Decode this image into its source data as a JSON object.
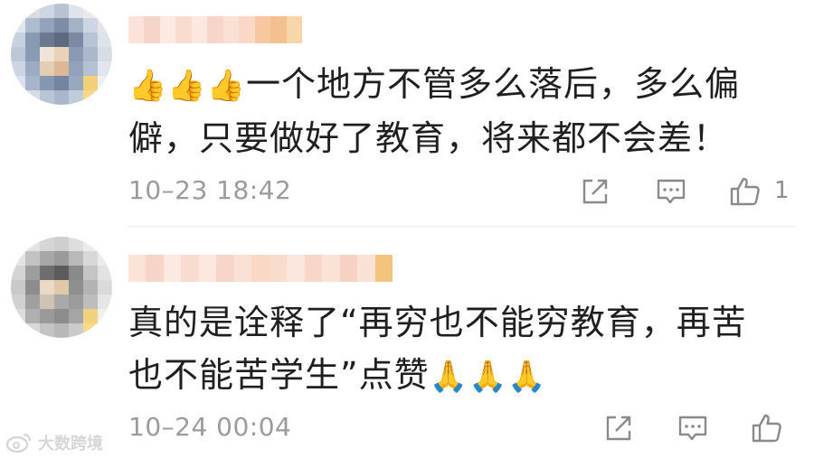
{
  "comments": [
    {
      "text_prefix": "👍👍👍",
      "text": "一个地方不管多么落后，多么偏僻，只要做好了教育，将来都不会差！",
      "time": "10–23 18:42",
      "like_count": "1",
      "avatar_colors": [
        "#e9e9e9",
        "#dcdcdc",
        "#cfd6e3",
        "#b8c2d1",
        "#dde4ec",
        "#eaeaea",
        "#f1f1f1",
        "#dfe6ee",
        "#aebccf",
        "#93a3ba",
        "#7d8da5",
        "#a4b2c6",
        "#cdd7e3",
        "#e6e6e6",
        "#c7d2e0",
        "#8899b2",
        "#6b7890",
        "#5d6a80",
        "#7b8aa2",
        "#b7c4d6",
        "#dde3ea",
        "#bcc8d8",
        "#8a9bb4",
        "#efe4d7",
        "#e8d2b8",
        "#8b9ab2",
        "#a9b8cb",
        "#d6dde6",
        "#ccd6e3",
        "#9aabc3",
        "#e4cdb3",
        "#dcb894",
        "#93a2ba",
        "#b3c1d3",
        "#e0e6ec",
        "#d9e1ea",
        "#a6b5c9",
        "#8596b1",
        "#7384a0",
        "#98a8bf",
        "#f2cf79",
        "#eef1f4",
        "#eef1f4",
        "#d4dce6",
        "#b9c5d5",
        "#a8b7cb",
        "#c1ccda",
        "#f6d886",
        "#f6f6f6"
      ],
      "name_colors": [
        "#fbe3d9",
        "#f6d4c8",
        "#fbe9e2",
        "#f8dccf",
        "#fce8de",
        "#f7d6c9",
        "#f9e0d5",
        "#fbd8c6",
        "#f8c79f",
        "#f5c08f",
        "#f8d6a8"
      ]
    },
    {
      "text_prefix": "",
      "text": "真的是诠释了“再穷也不能穷教育，再苦也不能苦学生”点赞",
      "text_suffix": "🙏🙏🙏",
      "time": "10–24 00:04",
      "like_count": "",
      "avatar_colors": [
        "#efefef",
        "#e3e3e3",
        "#d5d5d5",
        "#cfcfcf",
        "#dedede",
        "#ececec",
        "#f3f3f3",
        "#e3e3e3",
        "#c2c2c2",
        "#a7a7a7",
        "#9a9a9a",
        "#b9b9b9",
        "#d8d8d8",
        "#ebebeb",
        "#d4d4d4",
        "#9e9e9e",
        "#6e6e6e",
        "#5c5c5c",
        "#8a8a8a",
        "#c5c5c5",
        "#e2e2e2",
        "#c9c9c9",
        "#8d8d8d",
        "#e9d9c5",
        "#e0c8aa",
        "#8f8f8f",
        "#b3b3b3",
        "#dadada",
        "#d1d1d1",
        "#a0a0a0",
        "#cfc3b3",
        "#a9a9a9",
        "#9b9b9b",
        "#bdbdbd",
        "#e5e5e5",
        "#dcdcdc",
        "#b0b0b0",
        "#9a9a9a",
        "#8c8c8c",
        "#a5a5a5",
        "#f2d37d",
        "#f0f0f0",
        "#f1f1f1",
        "#d9d9d9",
        "#c4c4c4",
        "#b8b8b8",
        "#cbcbcb",
        "#f7da8a",
        "#f7f7f7"
      ],
      "name_colors": [
        "#fbe3d9",
        "#f6d4c8",
        "#fbe9e2",
        "#f8dccf",
        "#fce8de",
        "#f7d6c9",
        "#f9e0d5",
        "#fbd8c6",
        "#f9dccc",
        "#fbe6dd",
        "#f8d7c8",
        "#fbe2d7",
        "#f6d2c2",
        "#f9e1d6",
        "#f3c47e"
      ]
    }
  ],
  "watermark": {
    "text": "大数跨境"
  },
  "icons": {
    "share": "share-icon",
    "reply": "comment-icon",
    "like": "thumbs-up-icon",
    "watermark": "weibo-logo-icon"
  },
  "colors": {
    "text": "#1f1f1f",
    "meta": "#9b9b9b",
    "icon": "#8a8a8a"
  }
}
